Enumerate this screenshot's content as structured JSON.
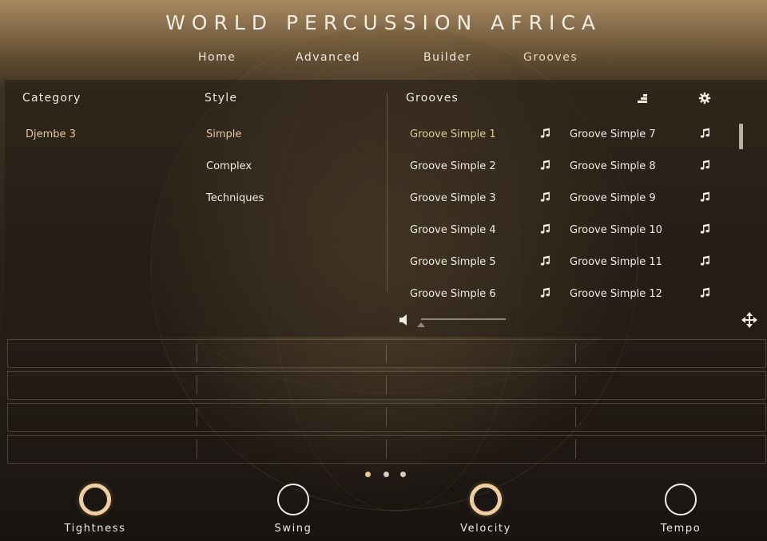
{
  "app": {
    "title": "WORLD PERCUSSION AFRICA"
  },
  "nav": [
    {
      "label": "Home"
    },
    {
      "label": "Advanced"
    },
    {
      "label": "Builder"
    },
    {
      "label": "Grooves"
    }
  ],
  "nav_active": "Grooves",
  "columns": {
    "category": "Category",
    "style": "Style",
    "grooves": "Grooves"
  },
  "categories": [
    {
      "label": "Djembe 3"
    }
  ],
  "styles": [
    {
      "label": "Simple"
    },
    {
      "label": "Complex"
    },
    {
      "label": "Techniques"
    }
  ],
  "grooves_left": [
    {
      "label": "Groove Simple 1"
    },
    {
      "label": "Groove Simple 2"
    },
    {
      "label": "Groove Simple 3"
    },
    {
      "label": "Groove Simple 4"
    },
    {
      "label": "Groove Simple 5"
    },
    {
      "label": "Groove Simple 6"
    }
  ],
  "grooves_right": [
    {
      "label": "Groove Simple 7"
    },
    {
      "label": "Groove Simple 8"
    },
    {
      "label": "Groove Simple 9"
    },
    {
      "label": "Groove Simple 10"
    },
    {
      "label": "Groove Simple 11"
    },
    {
      "label": "Groove Simple 12"
    }
  ],
  "icons": {
    "sort": "sort-bars-icon",
    "settings": "gear-icon",
    "groove_note": "music-note-icon",
    "volume": "speaker-icon",
    "move": "move-arrows-icon"
  },
  "volume_level": 0.0,
  "page_dots": [
    {
      "active": true
    },
    {
      "active": false
    },
    {
      "active": false
    }
  ],
  "knobs": [
    {
      "label": "Tightness",
      "lit": true
    },
    {
      "label": "Swing",
      "lit": false
    },
    {
      "label": "Velocity",
      "lit": true
    },
    {
      "label": "Tempo",
      "lit": false
    }
  ],
  "colors": {
    "accent": "#f0c684",
    "selected_text": "#e3c997",
    "text": "#f0ebe1"
  }
}
